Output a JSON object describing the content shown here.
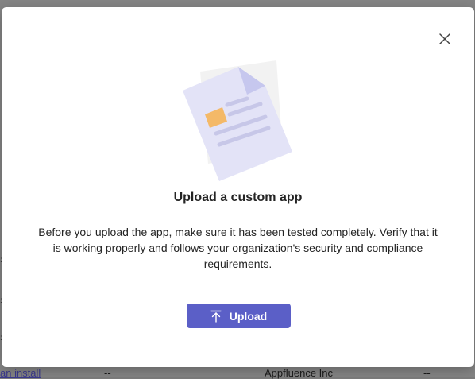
{
  "dialog": {
    "title": "Upload a custom app",
    "description": "Before you upload the app, make sure it has been tested completely. Verify that it is working properly and follows your organization's security and compliance requirements.",
    "upload_label": "Upload",
    "close_icon": "close-icon",
    "upload_icon": "upload-icon",
    "illustration_icon": "document-illustration"
  },
  "background_row": {
    "link_text": "an install",
    "dash_1": "--",
    "publisher": "Appfluence Inc",
    "dash_2": "--"
  },
  "colors": {
    "accent": "#5b5fc7",
    "overlay": "#858585",
    "text": "#242424"
  }
}
